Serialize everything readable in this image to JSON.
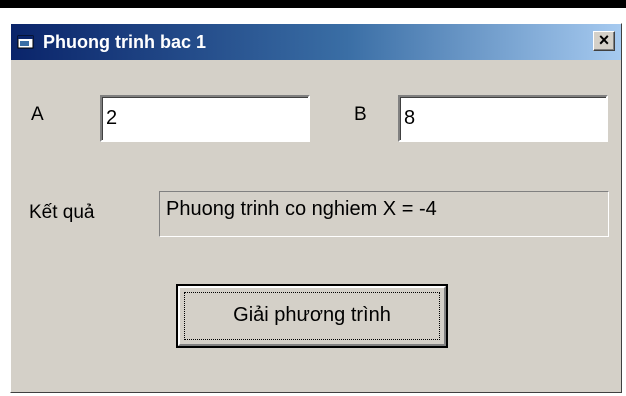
{
  "window": {
    "title": "Phuong trinh bac 1",
    "close_glyph": "×"
  },
  "form": {
    "a_label": "A",
    "a_value": "2",
    "b_label": "B",
    "b_value": "8",
    "result_label": "Kết quả",
    "result_value": "Phuong trinh co nghiem X = -4",
    "solve_button": "Giải phương trình"
  },
  "icons": {
    "app": "app-window-icon",
    "close": "close-icon"
  },
  "colors": {
    "titlebar_start": "#0a246a",
    "titlebar_end": "#a6caf0",
    "face": "#d4d0c8"
  }
}
